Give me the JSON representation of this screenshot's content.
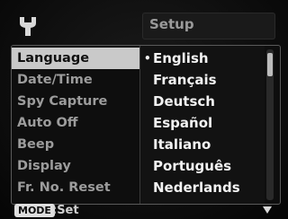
{
  "header": {
    "title": "Setup",
    "icon": "wrench-icon"
  },
  "menu": {
    "items": [
      {
        "label": "Language",
        "selected": true
      },
      {
        "label": "Date/Time",
        "selected": false
      },
      {
        "label": "Spy Capture",
        "selected": false
      },
      {
        "label": "Auto Off",
        "selected": false
      },
      {
        "label": "Beep",
        "selected": false
      },
      {
        "label": "Display",
        "selected": false
      },
      {
        "label": "Fr. No. Reset",
        "selected": false
      }
    ]
  },
  "options": {
    "current_marker": "•",
    "items": [
      {
        "label": "English",
        "current": true
      },
      {
        "label": "Français",
        "current": false
      },
      {
        "label": "Deutsch",
        "current": false
      },
      {
        "label": "Español",
        "current": false
      },
      {
        "label": "Italiano",
        "current": false
      },
      {
        "label": "Português",
        "current": false
      },
      {
        "label": "Nederlands",
        "current": false
      }
    ]
  },
  "footer": {
    "mode_key": "MODE",
    "action": ":Set",
    "scroll_icon": "down-arrow-icon"
  },
  "colors": {
    "selected_bg": "#c9c9c9",
    "option_text": "#f2f2f2",
    "item_text": "#9c9c9c"
  }
}
